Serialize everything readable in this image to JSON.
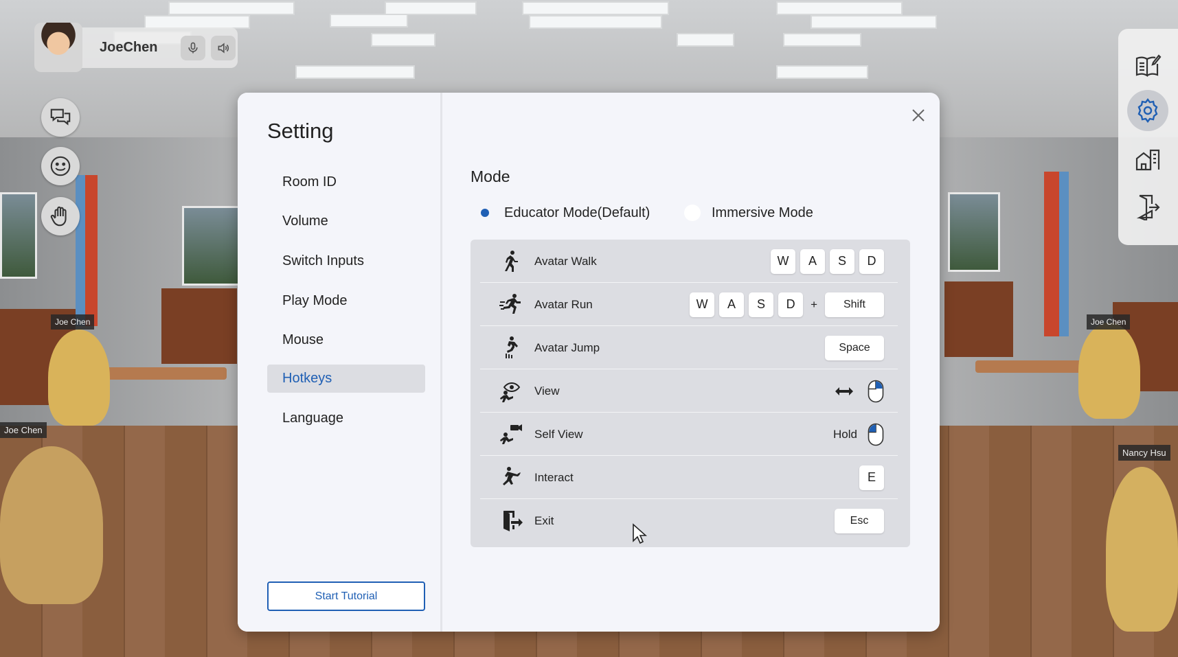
{
  "user": {
    "name": "JoeChen"
  },
  "scene": {
    "nametags": [
      "Joe Chen",
      "Joe Chen",
      "Joe Chen",
      "Joe Chen",
      "Nancy Hsu"
    ]
  },
  "left_buttons": [
    "chat-icon",
    "emoji-icon",
    "raise-hand-icon"
  ],
  "right_toolbar": [
    "notes-icon",
    "settings-icon",
    "building-icon",
    "exit-door-icon"
  ],
  "modal": {
    "title": "Setting",
    "menu": [
      "Room ID",
      "Volume",
      "Switch Inputs",
      "Play Mode",
      "Mouse",
      "Hotkeys",
      "Language"
    ],
    "active_menu": "Hotkeys",
    "tutorial_button": "Start Tutorial",
    "mode_title": "Mode",
    "modes": [
      {
        "label": "Educator Mode(Default)",
        "selected": true
      },
      {
        "label": "Immersive Mode",
        "selected": false
      }
    ],
    "hotkeys": [
      {
        "label": "Avatar Walk",
        "keys": [
          "W",
          "A",
          "S",
          "D"
        ]
      },
      {
        "label": "Avatar Run",
        "keys": [
          "W",
          "A",
          "S",
          "D"
        ],
        "plus": "+",
        "extra": "Shift"
      },
      {
        "label": "Avatar Jump",
        "keys": [
          "Space"
        ]
      },
      {
        "label": "View",
        "keys": [],
        "mouse": "drag"
      },
      {
        "label": "Self View",
        "keys": [],
        "hold": "Hold",
        "mouse": "hold"
      },
      {
        "label": "Interact",
        "keys": [
          "E"
        ]
      },
      {
        "label": "Exit",
        "keys": [
          "Esc"
        ]
      }
    ]
  },
  "colors": {
    "accent": "#1f5fb4",
    "panel": "#f4f5fa",
    "table": "#dcdde2"
  }
}
